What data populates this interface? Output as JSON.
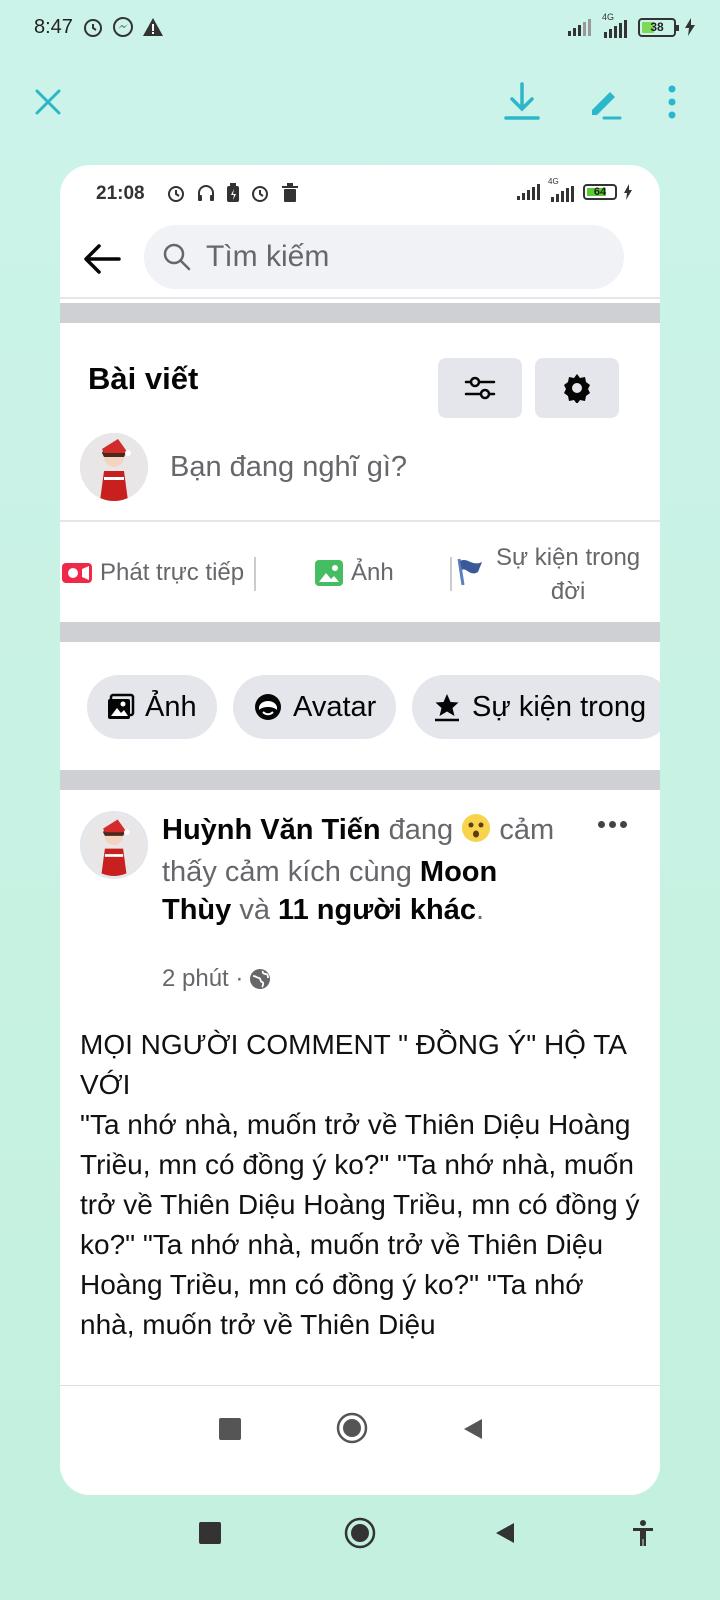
{
  "status_bar": {
    "time": "8:47",
    "battery": "38",
    "network": "4G"
  },
  "viewer_toolbar": {
    "close_icon": "close-icon",
    "download_icon": "download-icon",
    "edit_icon": "edit-icon",
    "more_icon": "more-vertical-icon"
  },
  "inner": {
    "status_bar": {
      "time": "21:08",
      "battery": "64",
      "network": "4G"
    },
    "search": {
      "placeholder": "Tìm kiếm"
    },
    "section_title": "Bài viết",
    "composer": {
      "placeholder": "Bạn đang nghĩ gì?"
    },
    "actions": [
      {
        "label": "Phát trực tiếp",
        "icon": "live-video-icon"
      },
      {
        "label": "Ảnh",
        "icon": "photo-icon"
      },
      {
        "label_line1": "Sự kiện trong",
        "label_line2": "đời",
        "icon": "flag-icon"
      }
    ],
    "chips": [
      {
        "label": "Ảnh",
        "icon": "photo-icon"
      },
      {
        "label": "Avatar",
        "icon": "avatar-icon"
      },
      {
        "label": "Sự kiện trong",
        "icon": "star-icon"
      }
    ],
    "post": {
      "author": "Huỳnh Văn Tiến",
      "feeling_prefix": "đang",
      "feeling_text": "cảm thấy cảm kích cùng",
      "tagged": "Moon Thùy",
      "conj": "và",
      "others": "11 người khác",
      "time": "2 phút ·",
      "body": "MỌI NGƯỜI COMMENT \" ĐỒNG Ý\" HỘ TA VỚI\n\"Ta nhớ nhà, muốn trở về Thiên Diệu Hoàng Triều, mn có đồng ý ko?\" \"Ta nhớ nhà, muốn trở về Thiên Diệu Hoàng Triều, mn có đồng ý ko?\" \"Ta nhớ nhà, muốn trở về Thiên Diệu Hoàng Triều, mn có đồng ý ko?\" \"Ta nhớ nhà, muốn trở về Thiên Diệu"
    }
  },
  "colors": {
    "accent": "#2bb7c9",
    "background": "#c8f2e4"
  }
}
